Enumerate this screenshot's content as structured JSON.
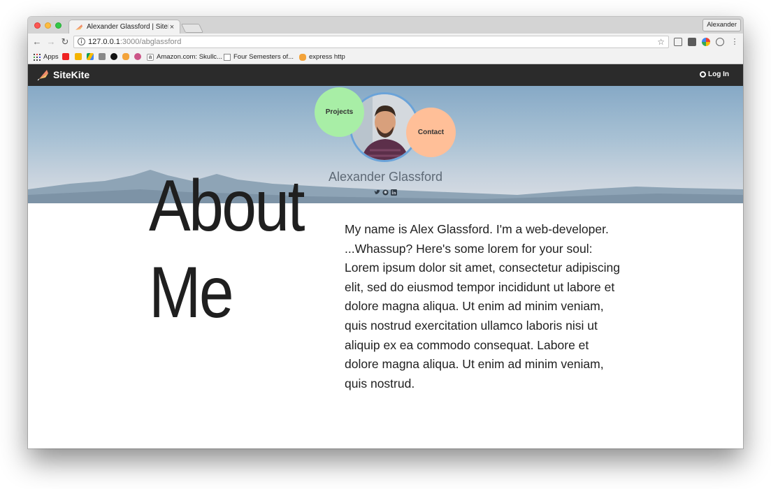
{
  "browser": {
    "tab_title": "Alexander Glassford | SiteKite",
    "tab_close": "×",
    "profile_name": "Alexander",
    "url_host": "127.0.0.1",
    "url_path": ":3000/abglassford",
    "bookmarks": [
      {
        "label": "Apps",
        "icon": "apps-grid-icon"
      },
      {
        "label": "",
        "icon": "adobe-icon"
      },
      {
        "label": "",
        "icon": "slides-icon"
      },
      {
        "label": "",
        "icon": "drive-icon"
      },
      {
        "label": "",
        "icon": "deploy-icon"
      },
      {
        "label": "",
        "icon": "github-icon"
      },
      {
        "label": "",
        "icon": "hand-icon"
      },
      {
        "label": "",
        "icon": "settings-icon"
      },
      {
        "label": "Amazon.com: Skullc...",
        "icon": "amazon-icon"
      },
      {
        "label": "Four Semesters of...",
        "icon": "page-icon"
      },
      {
        "label": "express http",
        "icon": "hand-icon"
      }
    ]
  },
  "site": {
    "brand": "SiteKite",
    "login_label": "Log In",
    "colors": {
      "navbar": "#2b2b2b",
      "projects": "#a8eea6",
      "contact": "#ffbf98",
      "avatar_ring": "#6aa3d9"
    }
  },
  "profile": {
    "projects_label": "Projects",
    "contact_label": "Contact",
    "name": "Alexander Glassford",
    "social_icons": [
      "twitter-icon",
      "github-icon",
      "linkedin-icon"
    ]
  },
  "about": {
    "title_line1": "About",
    "title_line2": "Me",
    "body": "My name is Alex Glassford. I'm a web-developer. ...Whassup? Here's some lorem for your soul: Lorem ipsum dolor sit amet, consectetur adipiscing elit, sed do eiusmod tempor incididunt ut labore et dolore magna aliqua. Ut enim ad minim veniam, quis nostrud exercitation ullamco laboris nisi ut aliquip ex ea commodo consequat. Labore et dolore magna aliqua. Ut enim ad minim veniam, quis nostrud."
  }
}
